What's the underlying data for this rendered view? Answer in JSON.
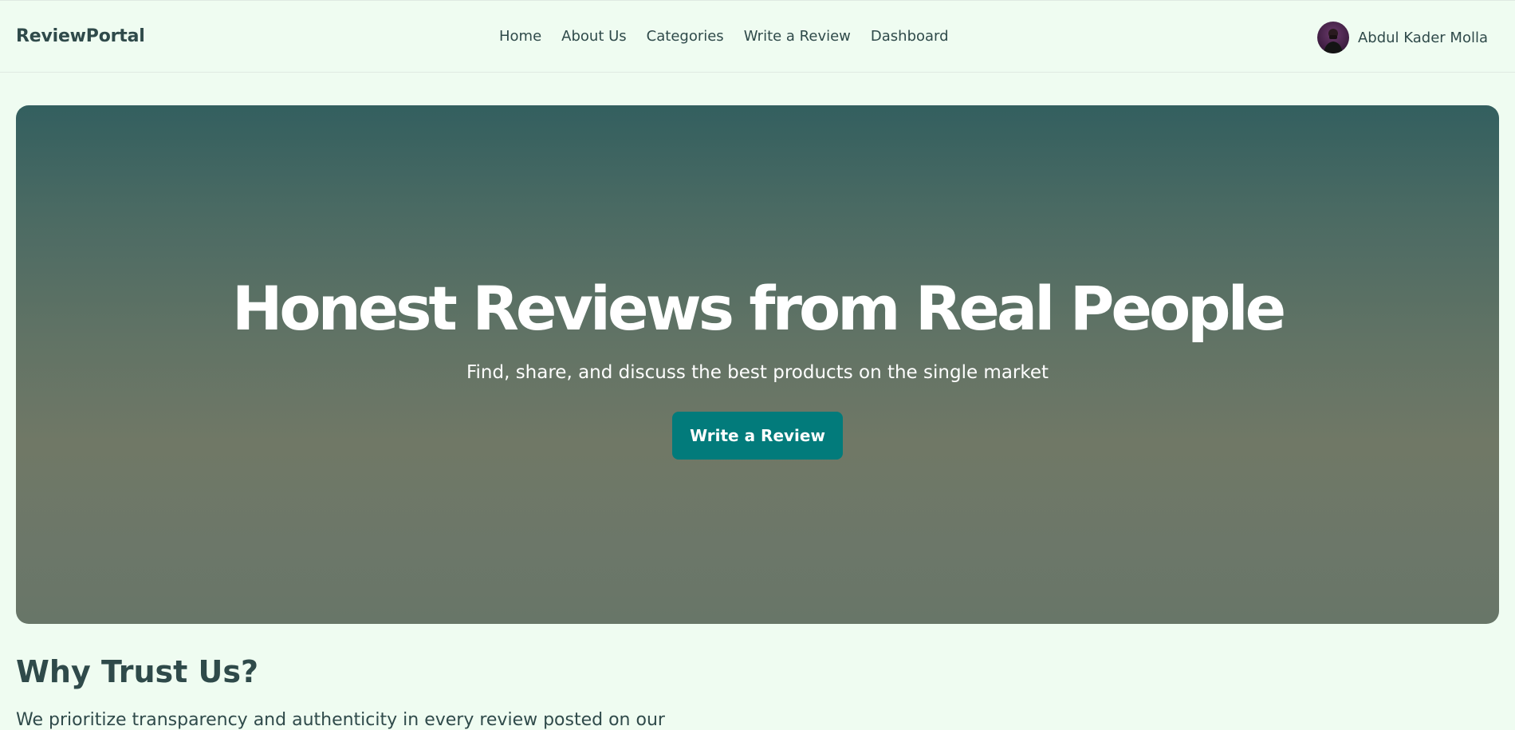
{
  "header": {
    "brand": "ReviewPortal",
    "nav": [
      {
        "label": "Home"
      },
      {
        "label": "About Us"
      },
      {
        "label": "Categories"
      },
      {
        "label": "Write a Review"
      },
      {
        "label": "Dashboard"
      }
    ],
    "user": {
      "name": "Abdul Kader Molla",
      "avatar_icon": "user-avatar-photo"
    }
  },
  "hero": {
    "title": "Honest Reviews from Real People",
    "subtitle": "Find, share, and discuss the best products on the single market",
    "cta_label": "Write a Review",
    "cta_color": "#027b7b"
  },
  "trust": {
    "title": "Why Trust Us?",
    "text": "We prioritize transparency and authenticity in every review posted on our"
  },
  "colors": {
    "background": "#effcf1",
    "text": "#2f4a4a"
  }
}
